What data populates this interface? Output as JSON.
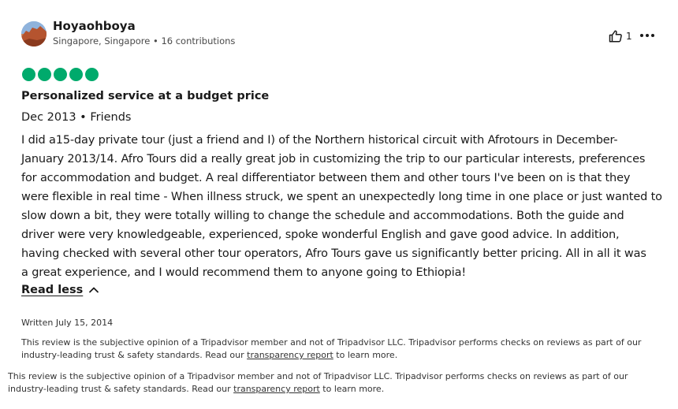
{
  "user": {
    "name": "Hoyaohboya",
    "location_contribs": "Singapore, Singapore • 16 contributions",
    "avatar_icon": "avatar-landscape"
  },
  "actions": {
    "helpful_icon": "thumbs-up-icon",
    "helpful_count": "1",
    "more_icon": "more-options-icon"
  },
  "rating": {
    "value": 5,
    "max": 5,
    "color": "#00aa6c"
  },
  "review": {
    "title": "Personalized service at a budget price",
    "date_type": "Dec 2013 • Friends",
    "lines": [
      "I did a15-day private tour (just a friend and I) of the Northern historical circuit with Afrotours in December-",
      "January 2013/14. Afro Tours did a really great job in customizing the trip to our particular interests, preferences",
      "for accommodation and budget. A real differentiator between them and other tours I've been on is that they",
      "were flexible in real time - When illness struck, we spent an unexpectedly long time in one place or just wanted to",
      "slow down a bit, they were totally willing to change the schedule and accommodations. Both the guide and",
      "driver were very knowledgeable, experienced, spoke wonderful English and gave good advice. In addition,",
      "having checked with several other tour operators, Afro Tours gave us significantly better pricing. All in all it was",
      "a great experience, and I would recommend them to anyone going to Ethiopia!"
    ],
    "read_less": "Read less",
    "written": "Written July 15, 2014"
  },
  "disclaimer": {
    "part1": "This review is the subjective opinion of a Tripadvisor member and not of Tripadvisor LLC. Tripadvisor performs checks on reviews as part of our",
    "part2": "industry-leading trust & safety standards. Read our ",
    "link": "transparency report",
    "part3": " to learn more."
  }
}
